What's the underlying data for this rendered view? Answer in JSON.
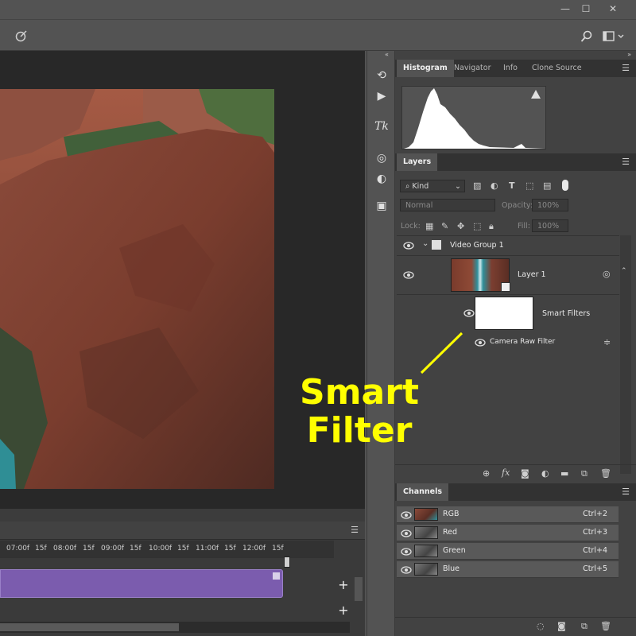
{
  "window": {
    "minimize": "—",
    "maximize": "☐",
    "close": "✕"
  },
  "histogram": {
    "tabs": [
      "Histogram",
      "Navigator",
      "Info",
      "Clone Source"
    ],
    "warning": "!"
  },
  "layers": {
    "tab": "Layers",
    "kind_label": "Kind",
    "blend_mode": "Normal",
    "opacity_label": "Opacity:",
    "opacity_value": "100%",
    "lock_label": "Lock:",
    "fill_label": "Fill:",
    "fill_value": "100%",
    "items": {
      "group": "Video Group 1",
      "layer1": "Layer 1",
      "smart_filters": "Smart Filters",
      "camera_raw": "Camera Raw Filter"
    }
  },
  "channels": {
    "tab": "Channels",
    "rows": [
      {
        "name": "RGB",
        "key": "Ctrl+2"
      },
      {
        "name": "Red",
        "key": "Ctrl+3"
      },
      {
        "name": "Green",
        "key": "Ctrl+4"
      },
      {
        "name": "Blue",
        "key": "Ctrl+5"
      }
    ]
  },
  "timeline": {
    "ticks": [
      "07:00f",
      "15f",
      "08:00f",
      "15f",
      "09:00f",
      "15f",
      "10:00f",
      "15f",
      "11:00f",
      "15f",
      "12:00f",
      "15f"
    ],
    "add": "+"
  },
  "annotation": {
    "line1": "Smart",
    "line2": "Filter",
    "color": "#ffff00"
  },
  "colors": {
    "clip": "#7b5cae",
    "panel": "#424242",
    "tab_active": "#535353"
  }
}
